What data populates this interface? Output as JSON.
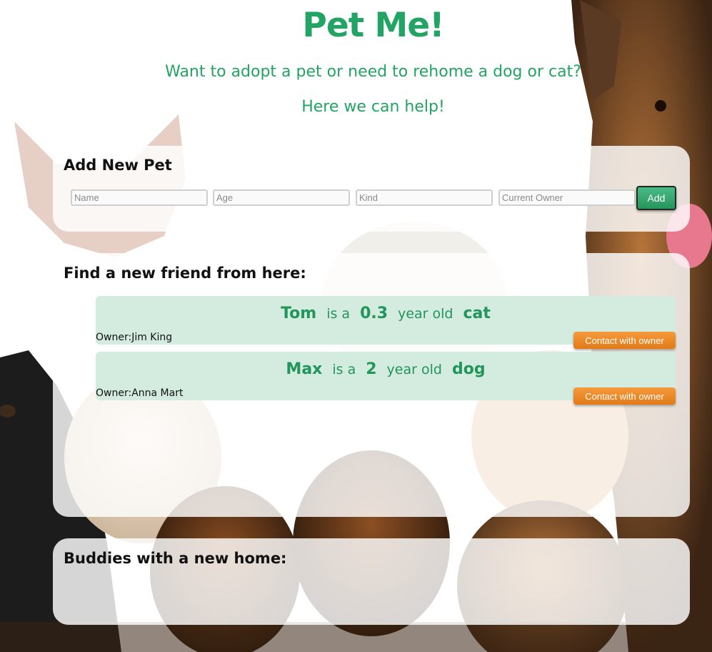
{
  "header": {
    "title": "Pet Me!",
    "subtitle_line1": "Want to adopt a pet or need to rehome a dog or cat?",
    "subtitle_line2": "Here we can help!"
  },
  "add_pet": {
    "heading": "Add New Pet",
    "name_placeholder": "Name",
    "age_placeholder": "Age",
    "kind_placeholder": "Kind",
    "owner_placeholder": "Current Owner",
    "add_label": "Add"
  },
  "find": {
    "heading": "Find a new friend from here:",
    "pets": [
      {
        "name": "Tom",
        "is_a": "is a",
        "age": "0.3",
        "year_old": "year old",
        "kind": "cat",
        "owner_label": "Owner:",
        "owner": "Jim King",
        "contact_label": "Contact with owner"
      },
      {
        "name": "Max",
        "is_a": "is a",
        "age": "2",
        "year_old": "year old",
        "kind": "dog",
        "owner_label": "Owner:",
        "owner": "Anna Mart",
        "contact_label": "Contact with owner"
      }
    ]
  },
  "buddies": {
    "heading": "Buddies with a new home:"
  },
  "colors": {
    "brand_green": "#21a464",
    "card_bg": "#d3ecdf",
    "contact_orange": "#f08a28"
  }
}
